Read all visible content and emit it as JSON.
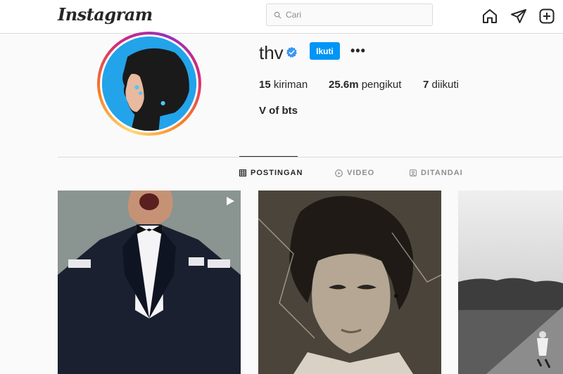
{
  "header": {
    "logo": "Instagram",
    "search_placeholder": "Cari",
    "icons": [
      "home-icon",
      "direct-message-icon",
      "new-post-icon",
      "search-icon"
    ]
  },
  "profile": {
    "username": "thv",
    "verified": true,
    "follow_label": "Ikuti",
    "more_label": "•••",
    "stats": {
      "posts_count": "15",
      "posts_label": "kiriman",
      "followers_count": "25.6m",
      "followers_label": "pengikut",
      "following_count": "7",
      "following_label": "diikuti"
    },
    "bio": "V of bts"
  },
  "tabs": [
    {
      "label": "POSTINGAN",
      "icon": "grid-icon",
      "active": true
    },
    {
      "label": "VIDEO",
      "icon": "play-circle-icon",
      "active": false
    },
    {
      "label": "DITANDAI",
      "icon": "tag-icon",
      "active": false
    }
  ],
  "posts": [
    {
      "type": "video",
      "icon": "reel-play-icon"
    },
    {
      "type": "photo"
    },
    {
      "type": "photo"
    }
  ],
  "colors": {
    "accent": "#0095f6",
    "verified": "#3897f0",
    "text": "#262626",
    "muted": "#8e8e8e",
    "border": "#dbdbdb"
  }
}
